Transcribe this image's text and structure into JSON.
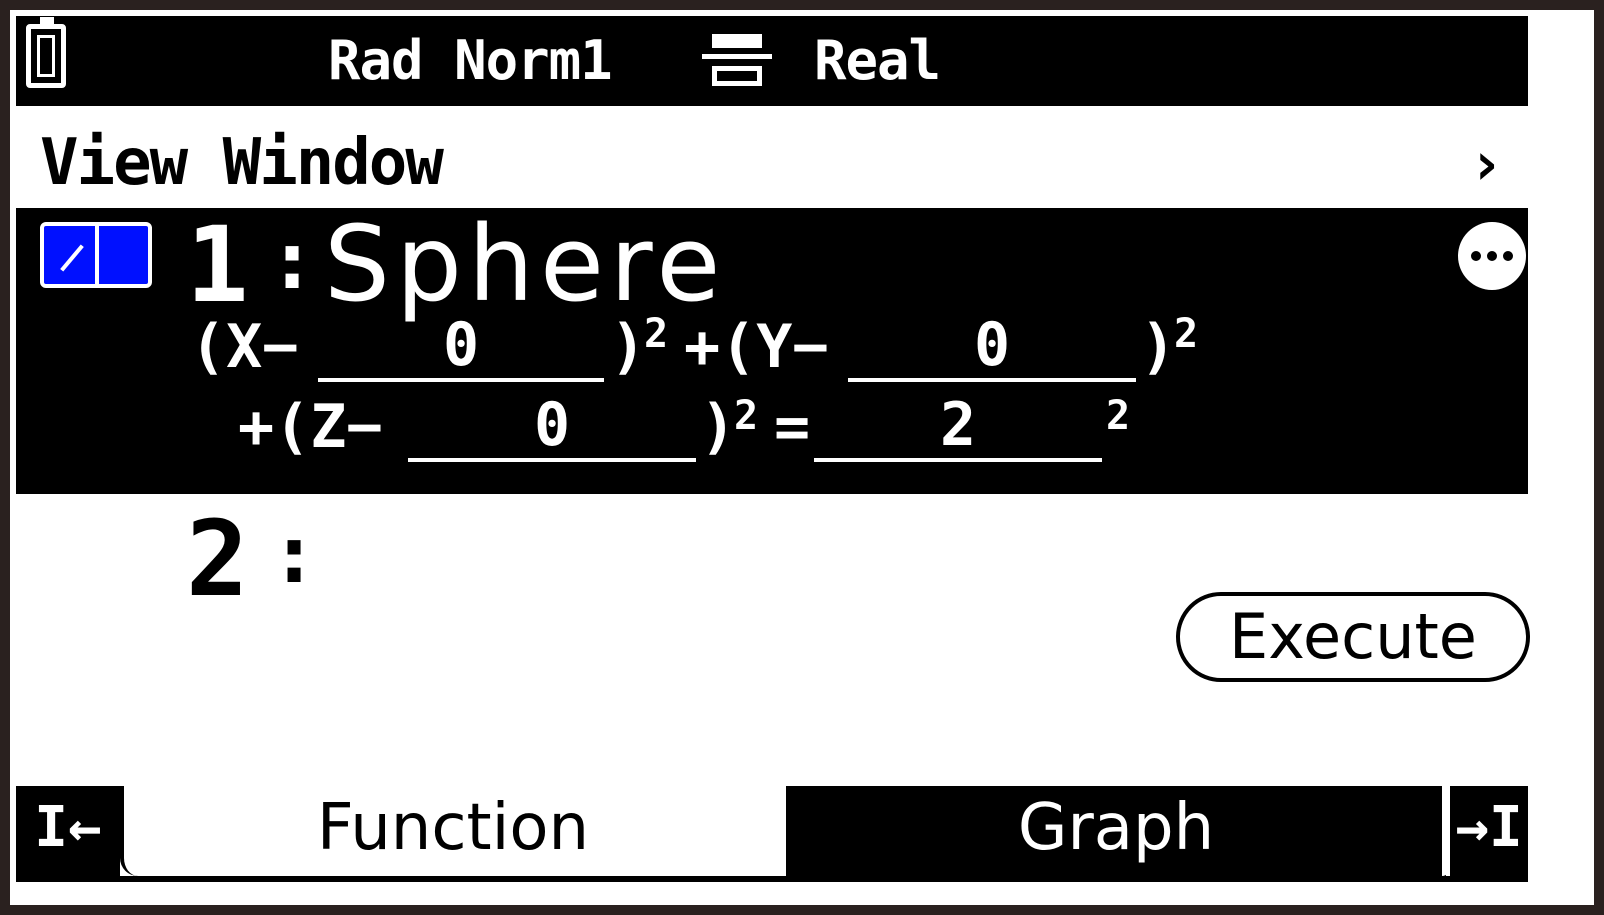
{
  "status_bar": {
    "angle_mode": "Rad",
    "display_mode": "Norm1",
    "complex_mode": "Real",
    "icons": [
      "battery-icon",
      "display-format-icon"
    ]
  },
  "header": {
    "title": "View Window",
    "chevron": "›"
  },
  "functions": [
    {
      "index": "1",
      "separator": ":",
      "name": "Sphere",
      "selected": true,
      "equation": {
        "x_open": "(X−",
        "x_center": "0",
        "x_close": ")",
        "plus_y_open": "+(Y−",
        "y_center": "0",
        "y_close": ")",
        "plus_z_open": "+(Z−",
        "z_center": "0",
        "z_close": ")",
        "equals": "=",
        "radius": "2",
        "exponent": "2"
      }
    },
    {
      "index": "2",
      "separator": ":"
    }
  ],
  "execute_button": "Execute",
  "tabs": {
    "left_arrow": "I←",
    "function": "Function",
    "graph": "Graph",
    "right_arrow": "→I"
  },
  "colors": {
    "checkbox_fill": "#0010ff",
    "background": "#ffffff",
    "selection": "#000000",
    "bezel": "#2a211f"
  }
}
